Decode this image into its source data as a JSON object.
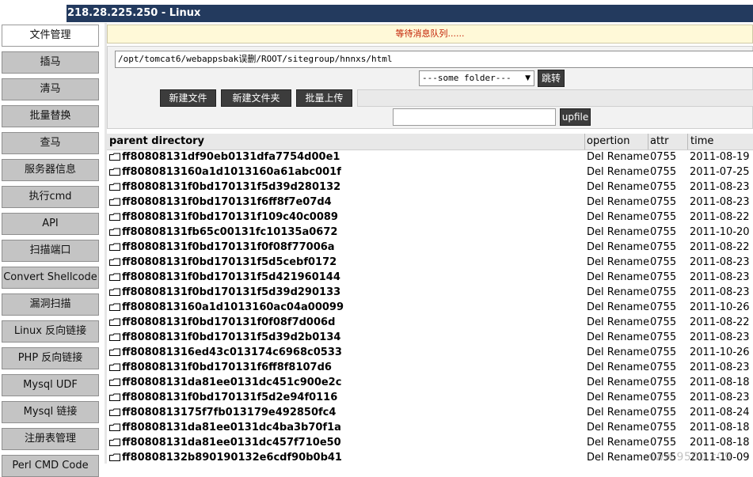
{
  "window": {
    "title": "218.28.225.250 - Linux"
  },
  "sidebar": {
    "items": [
      {
        "label": "文件管理",
        "active": true
      },
      {
        "label": "插马"
      },
      {
        "label": "清马"
      },
      {
        "label": "批量替换"
      },
      {
        "label": "查马"
      },
      {
        "label": "服务器信息"
      },
      {
        "label": "执行cmd"
      },
      {
        "label": "API"
      },
      {
        "label": "扫描端口"
      },
      {
        "label": "Convert Shellcode"
      },
      {
        "label": "漏洞扫描"
      },
      {
        "label": "Linux 反向链接"
      },
      {
        "label": "PHP 反向链接"
      },
      {
        "label": "Mysql UDF"
      },
      {
        "label": "Mysql 链接"
      },
      {
        "label": "注册表管理"
      },
      {
        "label": "Perl CMD Code"
      }
    ]
  },
  "message": {
    "text": "等待消息队列......"
  },
  "toolbar": {
    "path_value": "/opt/tomcat6/webappsbak误删/ROOT/sitegroup/hnnxs/html",
    "folder_select": "---some folder---",
    "jump_label": "跳转",
    "new_file_label": "新建文件",
    "new_folder_label": "新建文件夹",
    "batch_upload_label": "批量上传",
    "upfile_label": "upfile"
  },
  "table": {
    "headers": {
      "name": "parent directory",
      "operation": "opertion",
      "attr": "attr",
      "time": "time"
    },
    "rows": [
      {
        "name": "ff80808131df90eb0131dfa7754d00e1",
        "op": "Del Rename",
        "attr": "0755",
        "time": "2011-08-19"
      },
      {
        "name": "ff8080813160a1d1013160a61abc001f",
        "op": "Del Rename",
        "attr": "0755",
        "time": "2011-07-25"
      },
      {
        "name": "ff80808131f0bd170131f5d39d280132",
        "op": "Del Rename",
        "attr": "0755",
        "time": "2011-08-23"
      },
      {
        "name": "ff80808131f0bd170131f6ff8f7e07d4",
        "op": "Del Rename",
        "attr": "0755",
        "time": "2011-08-23"
      },
      {
        "name": "ff80808131f0bd170131f109c40c0089",
        "op": "Del Rename",
        "attr": "0755",
        "time": "2011-08-22"
      },
      {
        "name": "ff80808131fb65c00131fc10135a0672",
        "op": "Del Rename",
        "attr": "0755",
        "time": "2011-10-20"
      },
      {
        "name": "ff80808131f0bd170131f0f08f77006a",
        "op": "Del Rename",
        "attr": "0755",
        "time": "2011-08-22"
      },
      {
        "name": "ff80808131f0bd170131f5d5cebf0172",
        "op": "Del Rename",
        "attr": "0755",
        "time": "2011-08-23"
      },
      {
        "name": "ff80808131f0bd170131f5d421960144",
        "op": "Del Rename",
        "attr": "0755",
        "time": "2011-08-23"
      },
      {
        "name": "ff80808131f0bd170131f5d39d290133",
        "op": "Del Rename",
        "attr": "0755",
        "time": "2011-08-23"
      },
      {
        "name": "ff8080813160a1d1013160ac04a00099",
        "op": "Del Rename",
        "attr": "0755",
        "time": "2011-10-26"
      },
      {
        "name": "ff80808131f0bd170131f0f08f7d006d",
        "op": "Del Rename",
        "attr": "0755",
        "time": "2011-08-22"
      },
      {
        "name": "ff80808131f0bd170131f5d39d2b0134",
        "op": "Del Rename",
        "attr": "0755",
        "time": "2011-08-23"
      },
      {
        "name": "ff808081316ed43c013174c6968c0533",
        "op": "Del Rename",
        "attr": "0755",
        "time": "2011-10-26"
      },
      {
        "name": "ff80808131f0bd170131f6ff8f8107d6",
        "op": "Del Rename",
        "attr": "0755",
        "time": "2011-08-23"
      },
      {
        "name": "ff80808131da81ee0131dc451c900e2c",
        "op": "Del Rename",
        "attr": "0755",
        "time": "2011-08-18"
      },
      {
        "name": "ff80808131f0bd170131f5d2e94f0116",
        "op": "Del Rename",
        "attr": "0755",
        "time": "2011-08-23"
      },
      {
        "name": "ff8080813175f7fb013179e492850fc4",
        "op": "Del Rename",
        "attr": "0755",
        "time": "2011-08-24"
      },
      {
        "name": "ff80808131da81ee0131dc4ba3b70f1a",
        "op": "Del Rename",
        "attr": "0755",
        "time": "2011-08-18"
      },
      {
        "name": "ff80808131da81ee0131dc457f710e50",
        "op": "Del Rename",
        "attr": "0755",
        "time": "2011-08-18"
      },
      {
        "name": "ff80808132b890190132e6cdf90b0b41",
        "op": "Del Rename",
        "attr": "0755",
        "time": "2011-10-09"
      }
    ]
  },
  "watermark": "www.9500.c09"
}
